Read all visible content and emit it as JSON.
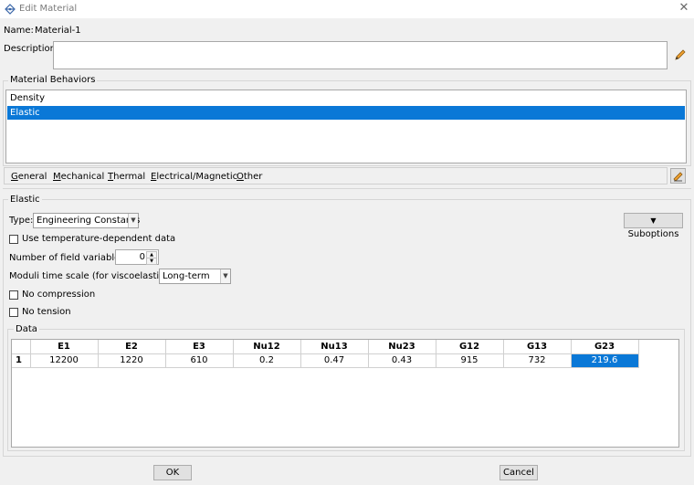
{
  "window": {
    "title": "Edit Material"
  },
  "name": {
    "label": "Name:",
    "value": "Material-1"
  },
  "description": {
    "label": "Description:",
    "value": ""
  },
  "behaviors": {
    "legend": "Material Behaviors",
    "items": [
      {
        "label": "Density"
      },
      {
        "label": "Elastic"
      }
    ],
    "selected": "Elastic"
  },
  "menu": [
    {
      "label": "General",
      "mnemonic": "G",
      "rest": "eneral"
    },
    {
      "label": "Mechanical",
      "mnemonic": "M",
      "rest": "echanical"
    },
    {
      "label": "Thermal",
      "mnemonic": "T",
      "rest": "hermal"
    },
    {
      "label": "Electrical/Magnetic",
      "mnemonic": "E",
      "rest": "lectrical/Magnetic"
    },
    {
      "label": "Other",
      "mnemonic": "O",
      "rest": "ther"
    }
  ],
  "elastic": {
    "legend": "Elastic",
    "type_label": "Type:",
    "type_value": "Engineering Constants",
    "suboptions_label": "Suboptions",
    "temp_dependent_label": "Use temperature-dependent data",
    "temp_dependent_checked": false,
    "field_vars_label": "Number of field variables:",
    "field_vars_value": "0",
    "moduli_label": "Moduli time scale (for viscoelasticity):",
    "moduli_value": "Long-term",
    "no_compression_label": "No compression",
    "no_compression_checked": false,
    "no_tension_label": "No tension",
    "no_tension_checked": false
  },
  "data": {
    "legend": "Data",
    "columns": [
      "E1",
      "E2",
      "E3",
      "Nu12",
      "Nu13",
      "Nu23",
      "G12",
      "G13",
      "G23"
    ],
    "rows": [
      {
        "index": "1",
        "values": [
          "12200",
          "1220",
          "610",
          "0.2",
          "0.47",
          "0.43",
          "915",
          "732",
          "219.6"
        ]
      }
    ],
    "selected_cell": "G23"
  },
  "buttons": {
    "ok": "OK",
    "cancel": "Cancel"
  },
  "colors": {
    "selection": "#0a78d7",
    "background": "#f0f0f0"
  }
}
